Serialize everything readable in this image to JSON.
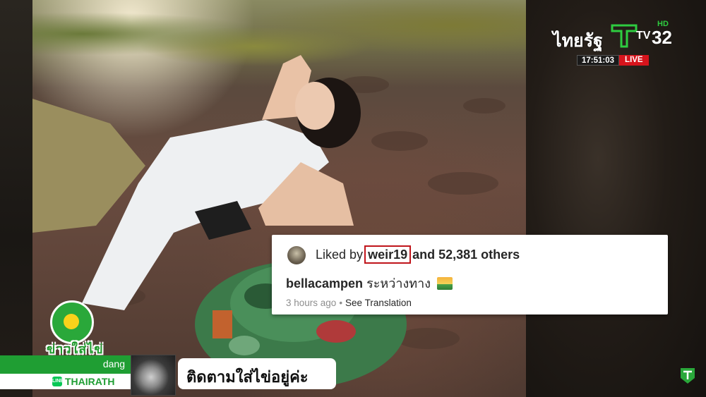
{
  "instagram": {
    "liked_prefix": "Liked by",
    "liked_user": "weir19",
    "liked_suffix": "and 52,381 others",
    "username": "bellacampen",
    "caption": "ระหว่างทาง",
    "timestamp": "3 hours ago",
    "dot": "•",
    "translate_label": "See Translation"
  },
  "station": {
    "logo_text": "ไทยรัฐ",
    "tv_label": "TV",
    "hd_label": "HD",
    "channel_number": "32",
    "clock": "17:51:03",
    "live_label": "LIVE"
  },
  "show": {
    "title": "ข่าวใส่ไข่"
  },
  "lower_third": {
    "name": "dang",
    "source": "THAIRATH",
    "line_icon_text": "LINE",
    "comment": "ติดตามใส่ไข่อยู่ค่ะ"
  },
  "colors": {
    "brand_green": "#1f9e33",
    "live_red": "#d6141c",
    "highlight_red": "#c0151b"
  }
}
